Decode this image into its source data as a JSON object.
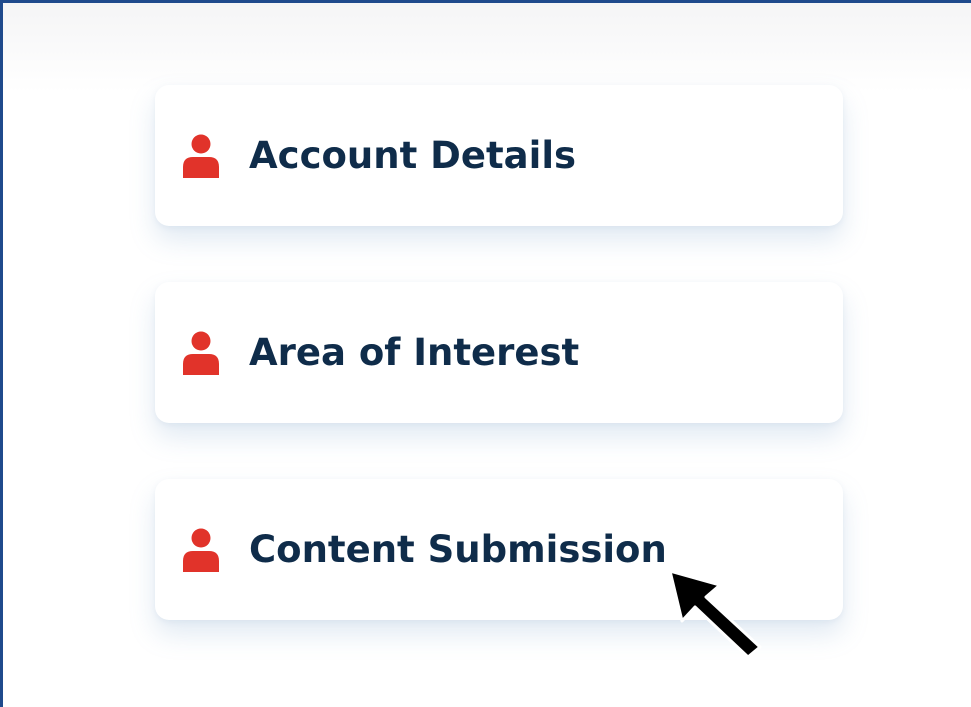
{
  "menu": {
    "items": [
      {
        "label": "Account Details",
        "icon": "user-icon"
      },
      {
        "label": "Area of Interest",
        "icon": "user-icon"
      },
      {
        "label": "Content Submission",
        "icon": "user-icon"
      }
    ]
  },
  "colors": {
    "icon_accent": "#e1332a",
    "label_text": "#0f2c4a",
    "frame_border": "#1f4a8c"
  },
  "cursor": {
    "icon": "arrow-cursor-icon"
  }
}
